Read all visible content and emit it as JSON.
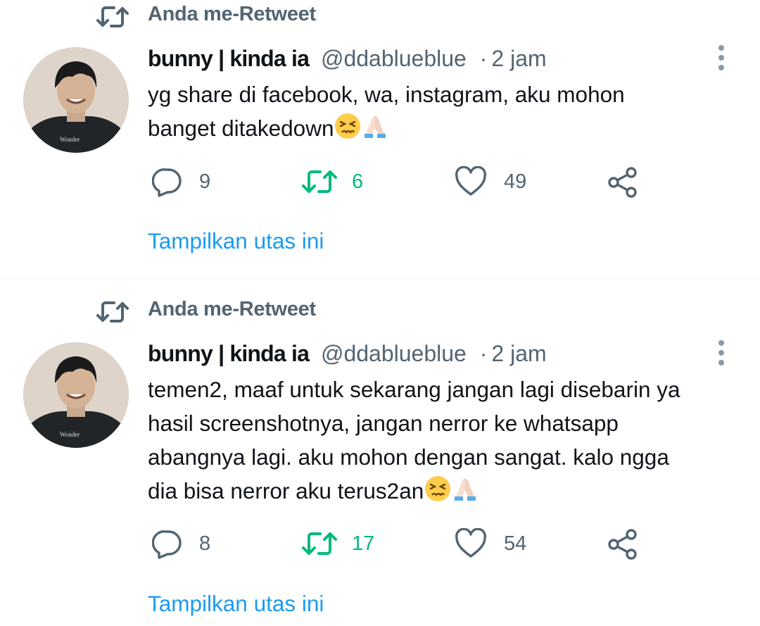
{
  "colors": {
    "text_primary": "#0f1419",
    "text_secondary": "#536471",
    "link": "#1d9bf0",
    "retweet_green": "#00ba7c"
  },
  "icons": {
    "reply": "reply-icon",
    "retweet": "retweet-icon",
    "like": "heart-icon",
    "share": "share-icon",
    "more": "more-vertical-icon"
  },
  "tweets": [
    {
      "context_label": "Anda me-Retweet",
      "author_name": "bunny | kinda ia",
      "handle": "@ddablueblue",
      "separator": "·",
      "time": "2 jam",
      "text": "yg share di facebook, wa, instagram, aku mohon\nbanget ditakedown",
      "emojis": [
        "persevering-face-emoji",
        "folded-hands-emoji"
      ],
      "reply_count": "9",
      "retweet_count": "6",
      "like_count": "49",
      "thread_link": "Tampilkan utas ini"
    },
    {
      "context_label": "Anda me-Retweet",
      "author_name": "bunny | kinda ia",
      "handle": "@ddablueblue",
      "separator": "·",
      "time": "2 jam",
      "text": "temen2, maaf untuk sekarang jangan lagi disebarin ya\nhasil screenshotnya, jangan nerror ke whatsapp\nabangnya lagi. aku mohon dengan sangat. kalo ngga\ndia bisa nerror aku terus2an",
      "emojis": [
        "persevering-face-emoji",
        "folded-hands-emoji"
      ],
      "reply_count": "8",
      "retweet_count": "17",
      "like_count": "54",
      "thread_link": "Tampilkan utas ini"
    }
  ]
}
